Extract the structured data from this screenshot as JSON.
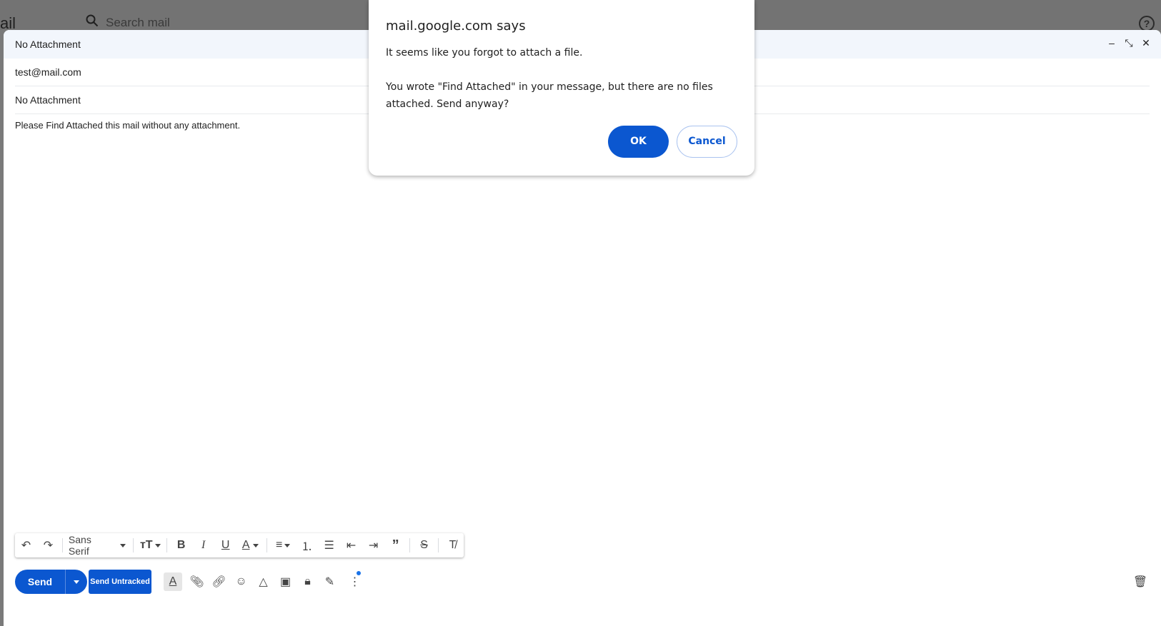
{
  "background": {
    "logo_fragment": "ail",
    "search_placeholder": "Search mail"
  },
  "compose": {
    "title": "No Attachment",
    "to": "test@mail.com",
    "subject": "No Attachment",
    "body": "Please Find Attached this mail without any attachment.",
    "header_icons": [
      "minimize-icon",
      "exit-fullscreen-icon",
      "close-icon"
    ]
  },
  "toolbar": {
    "font": "Sans Serif",
    "icons": [
      "undo-icon",
      "redo-icon",
      "font-size-icon",
      "bold-icon",
      "italic-icon",
      "underline-icon",
      "text-color-icon",
      "align-icon",
      "numbered-list-icon",
      "bulleted-list-icon",
      "indent-less-icon",
      "indent-more-icon",
      "quote-icon",
      "strikethrough-icon",
      "remove-formatting-icon"
    ]
  },
  "bottom": {
    "send_label": "Send",
    "untracked_label": "Send Untracked",
    "icons": [
      "formatting-options-icon",
      "attach-icon",
      "link-icon",
      "emoji-icon",
      "drive-icon",
      "photo-icon",
      "confidential-icon",
      "signature-icon",
      "more-options-icon",
      "delete-icon"
    ]
  },
  "dialog": {
    "title": "mail.google.com says",
    "message": "It seems like you forgot to attach a file.\n\nYou wrote \"Find Attached\" in your message, but there are no files attached. Send anyway?",
    "ok_label": "OK",
    "cancel_label": "Cancel"
  },
  "colors": {
    "primary": "#0b57d0",
    "header_bg": "#f2f6fc"
  }
}
